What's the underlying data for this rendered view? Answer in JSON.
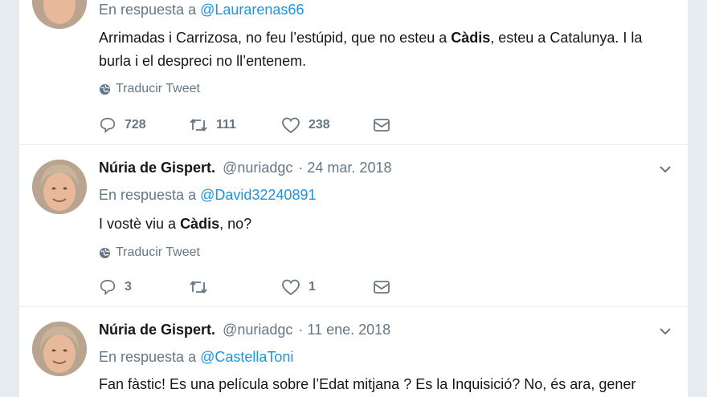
{
  "tweets": [
    {
      "replying_label": "En respuesta a",
      "reply_to": "@Laurarenas66",
      "text_before": "Arrimadas i Carrizosa, no feu l’estúpid, que no esteu a ",
      "text_bold": "Càdis",
      "text_after": ", esteu a Catalunya. I la burla i el despreci no ll’entenem.",
      "translate": "Traducir Tweet",
      "replies": "728",
      "retweets": "111",
      "likes": "238"
    },
    {
      "name": "Núria de Gispert.",
      "handle": "@nuriadgc",
      "date": "· 24 mar. 2018",
      "replying_label": "En respuesta a",
      "reply_to": "@David32240891",
      "text_before": "I vostè viu a ",
      "text_bold": "Càdis",
      "text_after": ", no?",
      "translate": "Traducir Tweet",
      "replies": "3",
      "retweets": "",
      "likes": "1"
    },
    {
      "name": "Núria de Gispert.",
      "handle": "@nuriadgc",
      "date": "· 11 ene. 2018",
      "replying_label": "En respuesta a",
      "reply_to": "@CastellaToni",
      "text": "Fan fàstic! Es una película sobre l’Edat mitjana ? Es la Inquisició? No, és ara, gener"
    }
  ],
  "icons": {
    "reply": "reply-icon",
    "retweet": "retweet-icon",
    "like": "heart-icon",
    "dm": "envelope-icon",
    "globe": "globe-icon",
    "caret": "chevron-down-icon"
  },
  "colors": {
    "link": "#1b95e0",
    "secondary_text": "#657786",
    "background": "#e6ecf0"
  }
}
